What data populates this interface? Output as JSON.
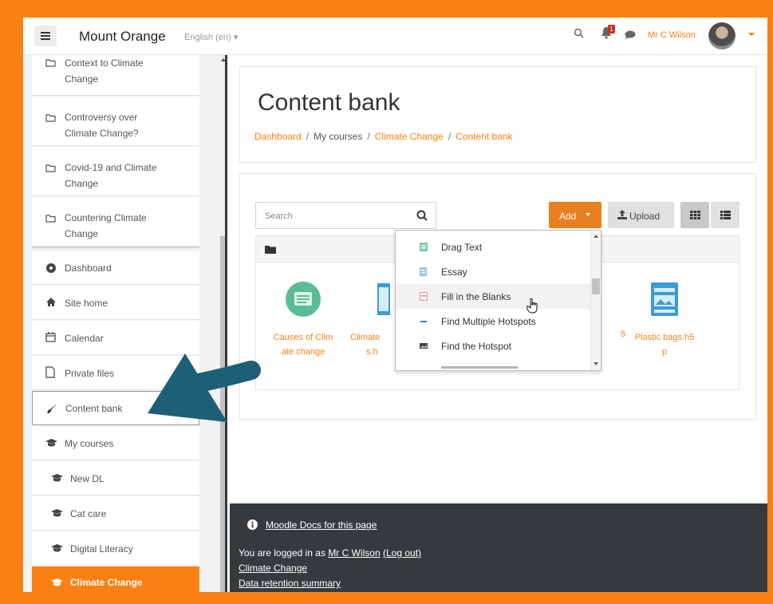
{
  "navbar": {
    "site_name": "Mount Orange",
    "language": "English (en)",
    "notification_count": "1",
    "user_name": "Mr C Wilson"
  },
  "drawer": {
    "sections": [
      {
        "label_1": "Context to Climate",
        "label_2": "Change"
      },
      {
        "label_1": "Controversy over",
        "label_2": "Climate Change?"
      },
      {
        "label_1": "Covid-19 and Climate",
        "label_2": "Change"
      },
      {
        "label_1": "Countering Climate",
        "label_2": "Change"
      }
    ],
    "nav": [
      {
        "label": "Dashboard",
        "icon": "dashboard-icon"
      },
      {
        "label": "Site home",
        "icon": "home-icon"
      },
      {
        "label": "Calendar",
        "icon": "calendar-icon"
      },
      {
        "label": "Private files",
        "icon": "file-icon"
      },
      {
        "label": "Content bank",
        "icon": "brush-icon"
      },
      {
        "label": "My courses",
        "icon": "graduation-cap-icon"
      },
      {
        "label": "New DL",
        "icon": "graduation-cap-icon"
      },
      {
        "label": "Cat care",
        "icon": "graduation-cap-icon"
      },
      {
        "label": "Digital Literacy",
        "icon": "graduation-cap-icon"
      },
      {
        "label": "Climate Change",
        "icon": "graduation-cap-icon"
      }
    ]
  },
  "page": {
    "title": "Content bank",
    "breadcrumb": [
      "Dashboard",
      "My courses",
      "Climate Change",
      "Content bank"
    ]
  },
  "content": {
    "search_placeholder": "Search",
    "add_label": "Add",
    "upload_label": "Upload",
    "files": [
      {
        "line1": "Causes of Clim",
        "line2": "ate change"
      },
      {
        "line1": "Climate",
        "line2": "s.h"
      },
      {
        "line1": "5",
        "line2": ""
      },
      {
        "line1": "Plastic bags.h5",
        "line2": "p"
      }
    ]
  },
  "add_menu": {
    "items": [
      {
        "label": "Drag Text",
        "icon": "drag-text-icon"
      },
      {
        "label": "Essay",
        "icon": "essay-icon"
      },
      {
        "label": "Fill in the Blanks",
        "icon": "fill-blanks-icon"
      },
      {
        "label": "Find Multiple Hotspots",
        "icon": "multiple-hotspots-icon"
      },
      {
        "label": "Find the Hotspot",
        "icon": "hotspot-icon"
      }
    ]
  },
  "footer": {
    "docs_link": "Moodle Docs for this page",
    "logged_prefix": "You are logged in as ",
    "logged_user": "Mr C Wilson",
    "logout": "(Log out)",
    "course_link": "Climate Change",
    "retention_link": "Data retention summary"
  },
  "colors": {
    "brand": "#f98012",
    "footer_bg": "#373a3c",
    "arrow": "#1d5f75"
  }
}
